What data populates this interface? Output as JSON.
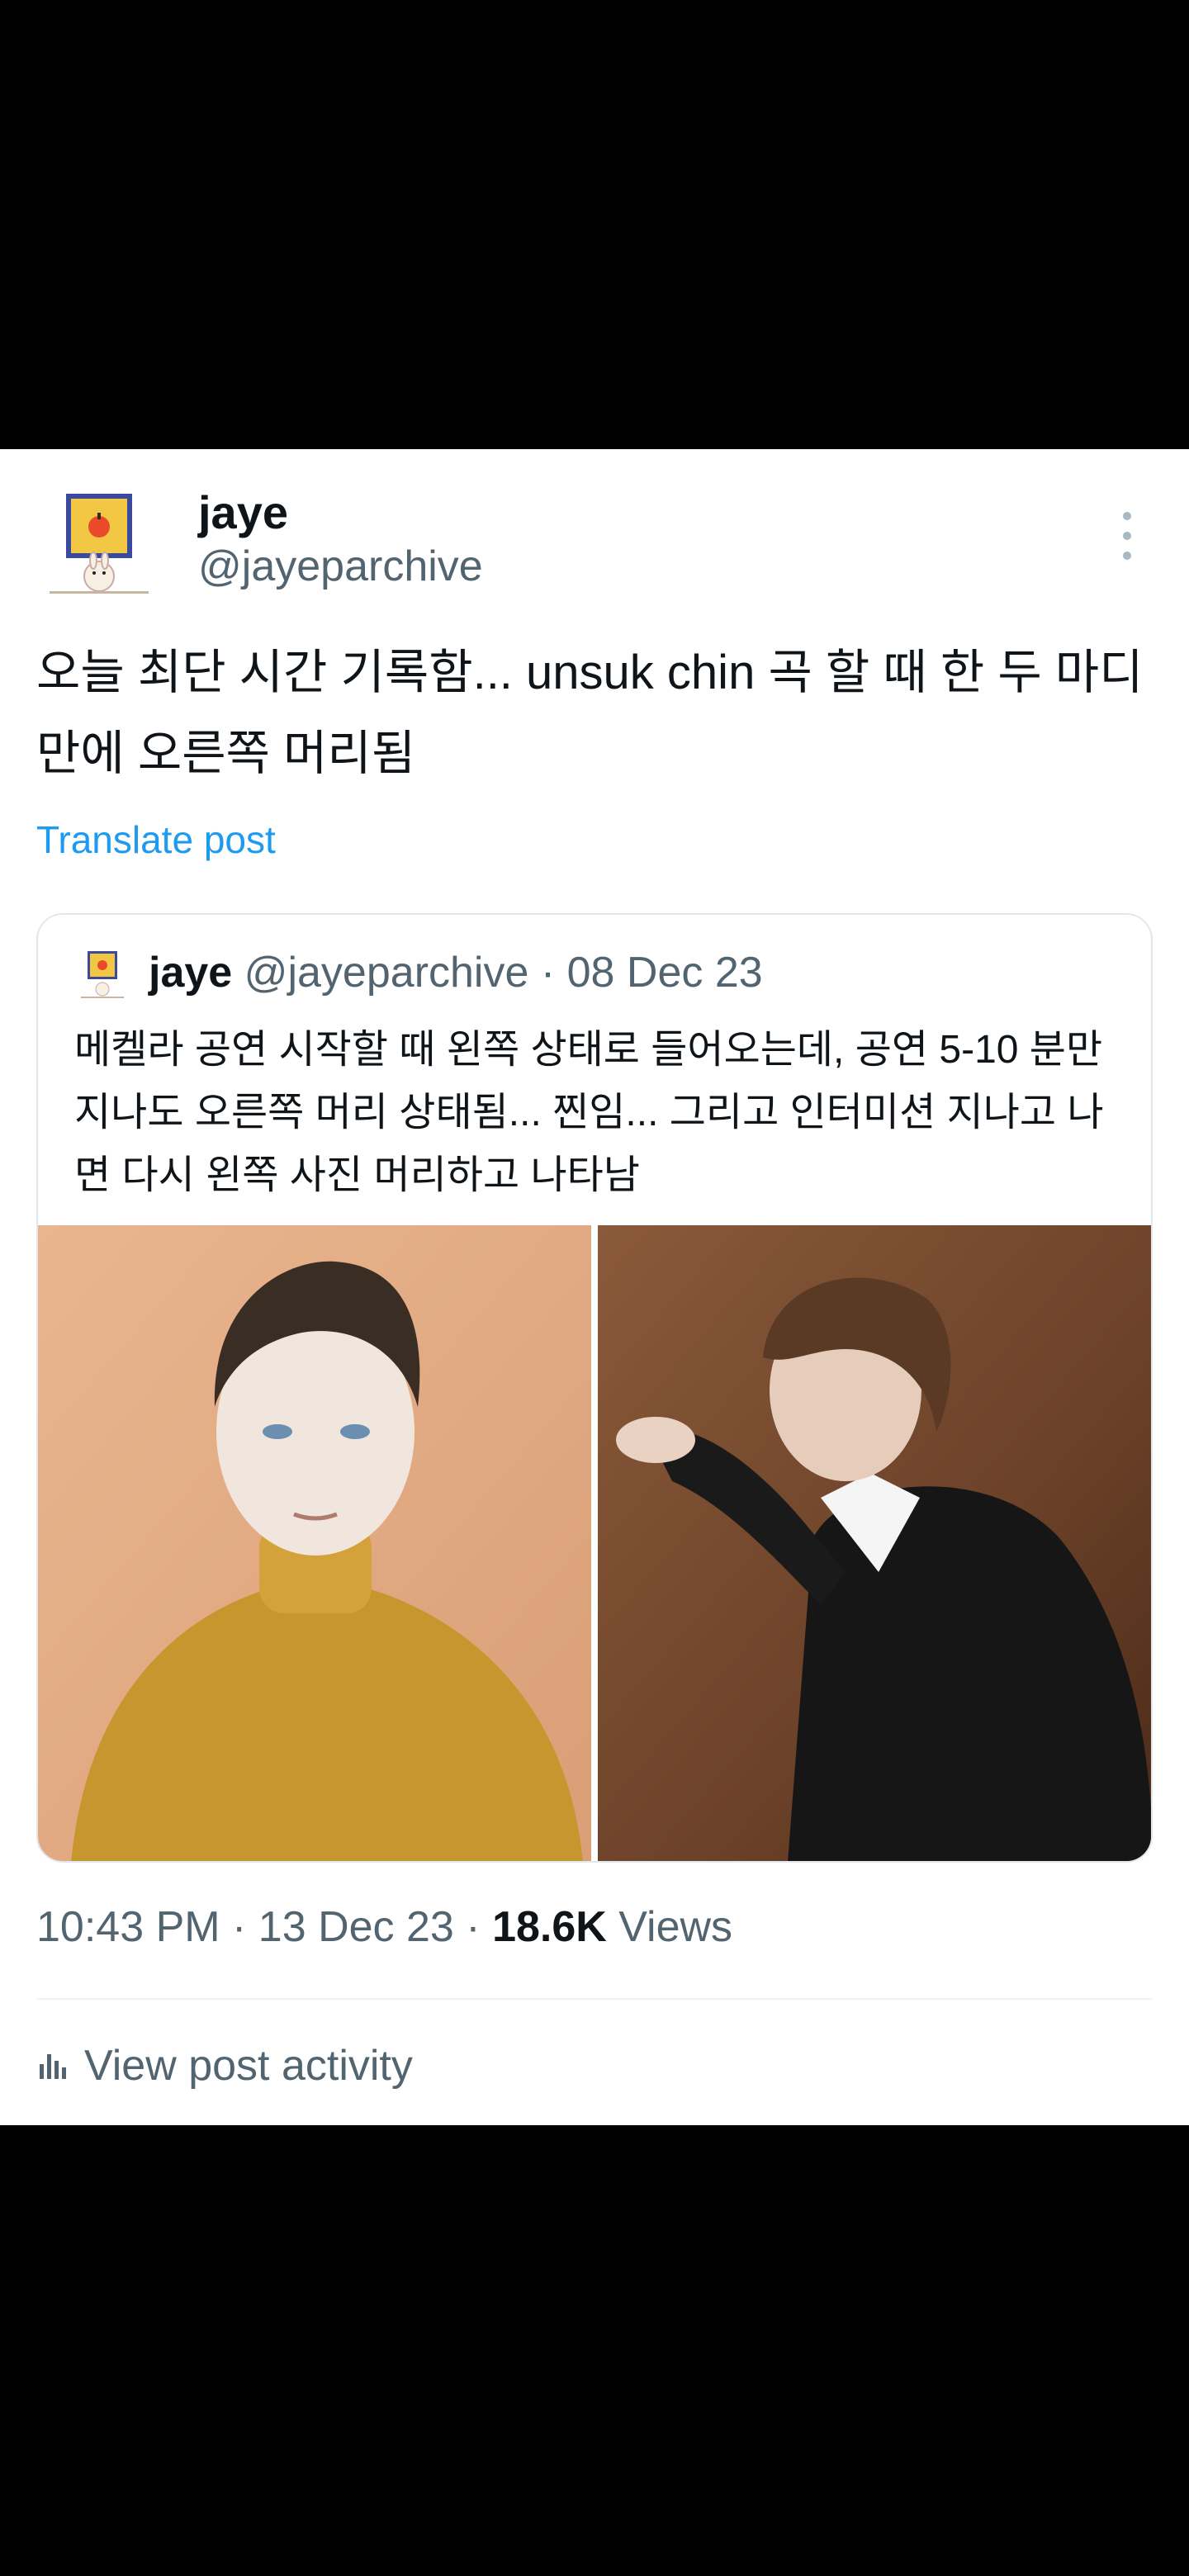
{
  "post": {
    "author_name": "jaye",
    "author_handle": "@jayeparchive",
    "text": "오늘 최단 시간 기록함... unsuk chin 곡 할 때 한 두 마디만에 오른쪽 머리됨",
    "translate_label": "Translate post",
    "quoted": {
      "author_name": "jaye",
      "author_handle": "@jayeparchive",
      "separator": "·",
      "date": "08 Dec 23",
      "text": "메켈라 공연 시작할 때 왼쪽 상태로 들어오는데, 공연 5-10 분만 지나도 오른쪽 머리 상태됨... 찐임... 그리고 인터미션 지나고 나면 다시 왼쪽 사진 머리하고 나타남"
    },
    "time": "10:43 PM",
    "date": "13 Dec 23",
    "views_count": "18.6K",
    "views_label": "Views",
    "activity_label": "View post activity"
  },
  "icons": {
    "more": "more-vertical-icon",
    "analytics": "bar-chart-icon"
  },
  "colors": {
    "link": "#1d9bf0",
    "text": "#0f1419",
    "secondary": "#536471"
  }
}
